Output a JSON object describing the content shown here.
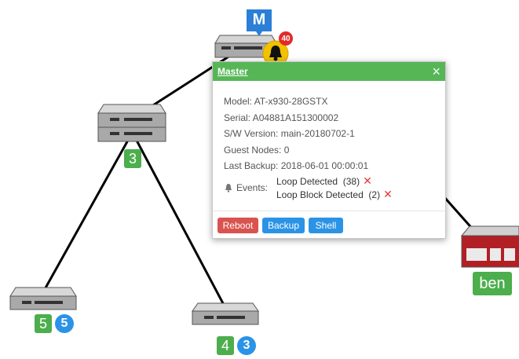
{
  "topology": {
    "master_marker_letter": "M",
    "alarm_count": "40",
    "nodes": [
      {
        "id": "node-a",
        "labels": [
          "3"
        ]
      },
      {
        "id": "node-b",
        "labels": [
          "5",
          "5"
        ]
      },
      {
        "id": "node-c",
        "labels": [
          "4",
          "3"
        ]
      },
      {
        "id": "node-ben",
        "labels": [
          "ben"
        ]
      }
    ]
  },
  "popup": {
    "title": "Master",
    "close": "×",
    "model": "Model: AT-x930-28GSTX",
    "serial": "Serial: A04881A151300002",
    "sw_version": "S/W Version: main-20180702-1",
    "guest_nodes": "Guest Nodes: 0",
    "last_backup": "Last Backup: 2018-06-01 00:00:01",
    "events_label": "Events:",
    "events": [
      {
        "text": "Loop Detected  (38)",
        "dismiss": "✕"
      },
      {
        "text": "Loop Block Detected  (2)",
        "dismiss": "✕"
      }
    ],
    "buttons": {
      "reboot": "Reboot",
      "backup": "Backup",
      "shell": "Shell"
    }
  },
  "colors": {
    "header_green": "#56b656",
    "badge_green": "#4cae4c",
    "badge_blue": "#2b93e6",
    "reboot_red": "#d9534f",
    "alarm_yellow": "#f2c200",
    "alarm_red": "#e32a2a"
  }
}
